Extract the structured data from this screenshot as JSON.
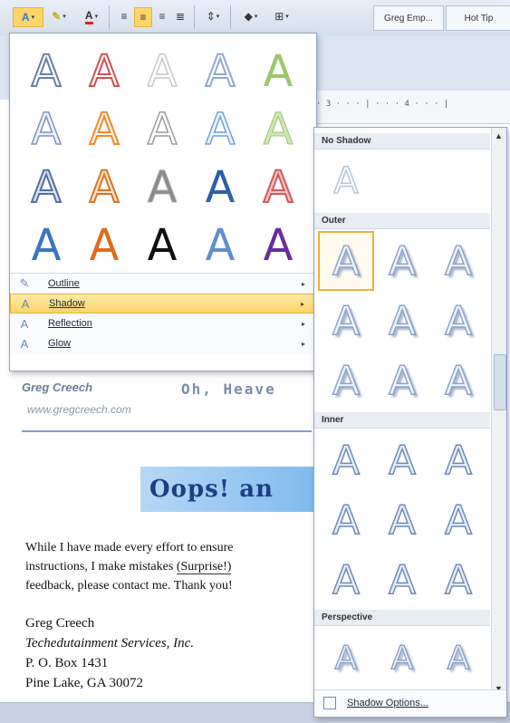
{
  "ribbon": {
    "font_color_icon": "A",
    "style_1": "Greg Emp...",
    "style_2": "Hot Tip"
  },
  "ruler": {
    "text": "· 3 · · · | · · · 4 · · · |"
  },
  "text_effects": {
    "letter": "A",
    "menu": [
      {
        "label": "Outline",
        "icon": "outline-icon"
      },
      {
        "label": "Shadow",
        "icon": "shadow-icon",
        "selected": true
      },
      {
        "label": "Reflection",
        "icon": "reflection-icon"
      },
      {
        "label": "Glow",
        "icon": "glow-icon"
      }
    ]
  },
  "document": {
    "signature_name": "Greg Creech",
    "url": "www.gregcreech.com",
    "heading_partial": "Oh, Heave",
    "banner_partial": "Oops! an",
    "body_line1": "While I have made every effort to ensure",
    "body_line2a": "instructions, I make mistakes",
    "body_line2b": "(Surprise!)",
    "body_line3": "feedback, please contact me.  Thank you!",
    "addr_name": "Greg Creech",
    "addr_company": "Techedutainment Services, Inc.",
    "addr_box": "P. O. Box 1431",
    "addr_city": "Pine Lake, GA  30072"
  },
  "shadow_panel": {
    "no_shadow_heading": "No Shadow",
    "outer_heading": "Outer",
    "inner_heading": "Inner",
    "perspective_heading": "Perspective",
    "options_label": "Shadow Options..."
  }
}
